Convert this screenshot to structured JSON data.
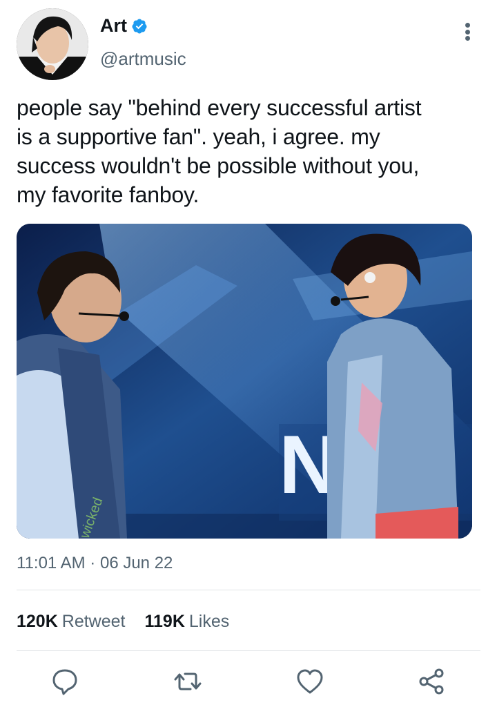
{
  "author": {
    "display_name": "Art",
    "handle": "@artmusic",
    "verified": true,
    "verified_color": "#1d9bf0"
  },
  "tweet": {
    "lines": [
      "people say \"behind every successful artist",
      "is a supportive fan\". yeah, i agree. my",
      "success wouldn't be possible without you,",
      "my favorite fanboy."
    ]
  },
  "media": {
    "description_icon": "concert-photo",
    "stage_sign_text": "N"
  },
  "meta": {
    "time": "11:01 AM",
    "separator": "·",
    "date": "06 Jun 22"
  },
  "stats": {
    "retweets_count": "120K",
    "retweets_label": "Retweet",
    "likes_count": "119K",
    "likes_label": "Likes"
  },
  "actions": [
    "reply-icon",
    "retweet-icon",
    "like-icon",
    "share-icon"
  ],
  "colors": {
    "text": "#0f1419",
    "secondary": "#536471",
    "divider": "#dfe3e6"
  }
}
